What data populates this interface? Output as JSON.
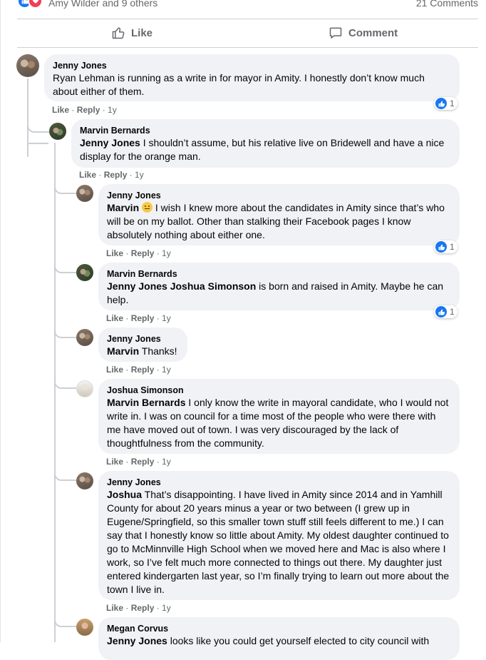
{
  "summary": {
    "reactors": "Amy Wilder and 9 others",
    "comments_count": "21 Comments"
  },
  "post_actions": {
    "like": "Like",
    "comment": "Comment"
  },
  "comment_action_like": "Like",
  "comment_action_reply": "Reply",
  "comment_time": "1y",
  "comments": [
    {
      "author": "Jenny Jones",
      "mention": "",
      "text": "Ryan Lehman is running as a write in for mayor in Amity. I honestly don’t know much about either of them.",
      "reactions": "1"
    },
    {
      "author": "Marvin Bernards",
      "mention": "Jenny Jones",
      "text": " I shouldn’t assume, but his relative live on Bridewell and have a nice display for the orange man.",
      "reactions": ""
    },
    {
      "author": "Jenny Jones",
      "mention": "Marvin",
      "text": " I wish I knew more about the candidates in Amity since that’s who will be on my ballot. Other than stalking their Facebook pages I know absolutely nothing about either one.",
      "reactions": "1"
    },
    {
      "author": "Marvin Bernards",
      "mention": "Jenny Jones Joshua Simonson",
      "text": " is born and raised in Amity. Maybe he can help.",
      "reactions": "1"
    },
    {
      "author": "Jenny Jones",
      "mention": "Marvin",
      "text": " Thanks!",
      "reactions": ""
    },
    {
      "author": "Joshua Simonson",
      "mention": "Marvin Bernards",
      "text": " I only know the write in mayoral candidate, who I would not write in. I was on council for a time most of the people who were there with me have moved out of town. I was very discouraged by the lack of thoughtfulness from the community.",
      "reactions": ""
    },
    {
      "author": "Jenny Jones",
      "mention": "Joshua",
      "text": " That’s disappointing. I have lived in Amity since 2014 and in Yamhill County for about 20 years minus a year or two between (I grew up in Eugene/Springfield, so this smaller town stuff still feels different to me.) I can say that I honestly know so little about Amity. My oldest daughter continued to go to McMinnville High School when we moved here and Mac is also where I work, so I’ve felt much more connected to things out there. My daughter just entered kindergarten last year, so I’m finally trying to learn out more about the town I live in.",
      "reactions": ""
    },
    {
      "author": "Megan Corvus",
      "mention": "Jenny Jones",
      "text": " looks like you could get yourself elected to city council with",
      "reactions": ""
    }
  ],
  "colors": {
    "like_blue": "#1877f2",
    "love_red": "#f33e58",
    "bubble": "#f0f2f5",
    "secondary_text": "#65676b"
  },
  "icons": [
    "like-reaction-icon",
    "love-reaction-icon",
    "thumbs-up-icon",
    "comment-icon",
    "frown-emoji-icon"
  ]
}
